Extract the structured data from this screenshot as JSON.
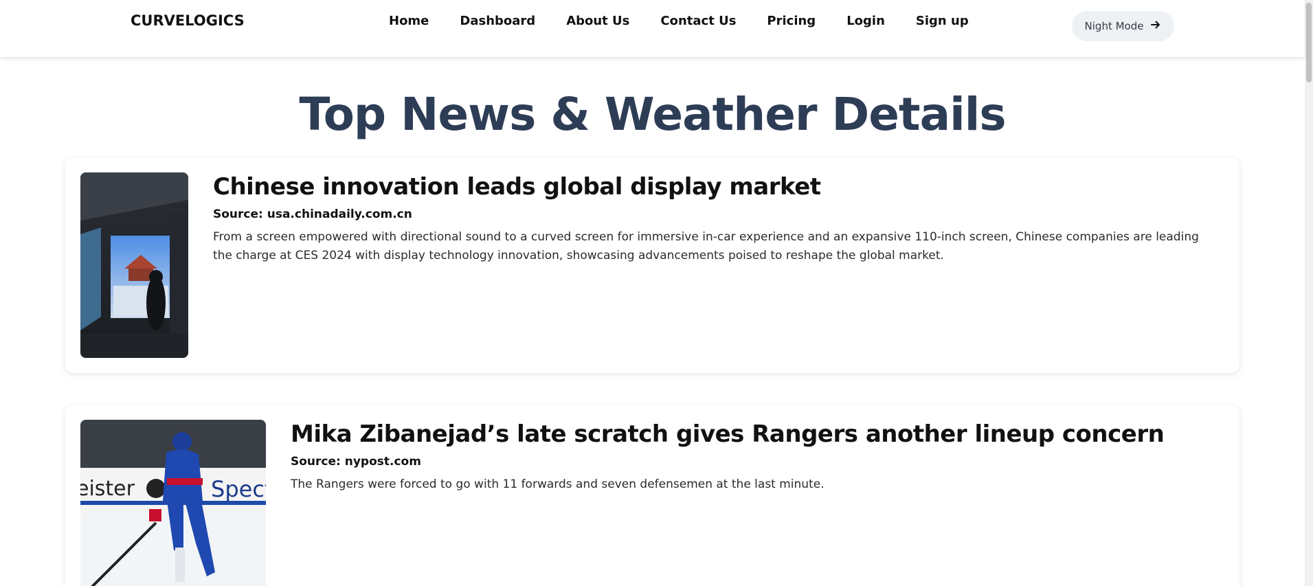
{
  "navbar": {
    "brand": "CURVELOGICS",
    "links": [
      "Home",
      "Dashboard",
      "About Us",
      "Contact Us",
      "Pricing",
      "Login",
      "Sign up"
    ],
    "night_mode_label": "Night Mode",
    "night_mode_icon": "arrow-right-icon"
  },
  "main": {
    "title": "Top News & Weather Details",
    "articles": [
      {
        "title": "Chinese innovation leads global display market",
        "source": "Source: usa.chinadaily.com.cn",
        "description": "From a screen empowered with directional sound to a curved screen for immersive in-car experience and an expansive 110-inch screen, Chinese companies are leading the charge at CES 2024 with display technology innovation, showcasing advancements poised to reshape the global market."
      },
      {
        "title": "Mika Zibanejad’s late scratch gives Rangers another lineup concern",
        "source": "Source: nypost.com",
        "description": "The Rangers were forced to go with 11 forwards and seven defensemen at the last minute."
      }
    ]
  },
  "colors": {
    "title": "#2e3d56",
    "night_button_bg": "#eef1f4"
  }
}
